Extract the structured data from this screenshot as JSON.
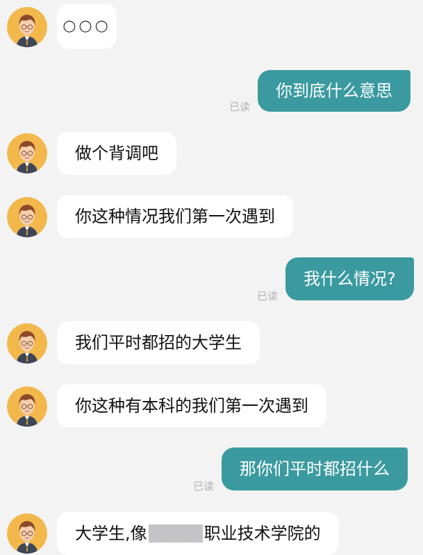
{
  "messages": {
    "m1": {
      "text": "○○○"
    },
    "m2": {
      "text": "你到底什么意思",
      "status": "已读"
    },
    "m3": {
      "text": "做个背调吧"
    },
    "m4": {
      "text": "你这种情况我们第一次遇到"
    },
    "m5": {
      "text": "我什么情况?",
      "status": "已读"
    },
    "m6": {
      "text": "我们平时都招的大学生"
    },
    "m7": {
      "text": "你这种有本科的我们第一次遇到"
    },
    "m8": {
      "text": "那你们平时都招什么",
      "status": "已读"
    },
    "m9": {
      "text_before": "大学生,像",
      "text_after": "职业技术学院的"
    }
  },
  "colors": {
    "outgoing_bubble": "#3a9aa0",
    "incoming_bubble": "#ffffff",
    "background": "#f3f3f3"
  },
  "icons": {
    "avatar": "cartoon-man-with-glasses-avatar"
  }
}
